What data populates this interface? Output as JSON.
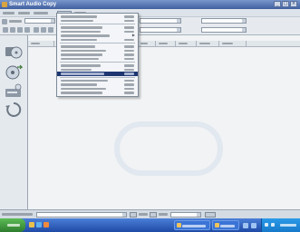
{
  "window": {
    "title": "Smart Audio Copy"
  },
  "dropdown": {
    "items": [
      {
        "type": "item"
      },
      {
        "type": "item"
      },
      {
        "type": "separator"
      },
      {
        "type": "item"
      },
      {
        "type": "item"
      },
      {
        "type": "item",
        "has_submenu": true
      },
      {
        "type": "item"
      },
      {
        "type": "separator"
      },
      {
        "type": "item"
      },
      {
        "type": "item"
      },
      {
        "type": "item"
      },
      {
        "type": "item"
      },
      {
        "type": "separator"
      },
      {
        "type": "item"
      },
      {
        "type": "item"
      },
      {
        "type": "item",
        "highlighted": true
      },
      {
        "type": "separator"
      },
      {
        "type": "item"
      },
      {
        "type": "item"
      },
      {
        "type": "item"
      },
      {
        "type": "item"
      }
    ]
  },
  "icons": {
    "sidebar": [
      "disc-copy-icon",
      "disc-rip-icon",
      "cd-drive-icon",
      "recycle-icon"
    ]
  },
  "colors": {
    "titlebar": "#3f5f9f",
    "menu_highlight": "#1e3772",
    "taskbar": "#1f4aa5",
    "start_button": "#2e7d2e"
  }
}
